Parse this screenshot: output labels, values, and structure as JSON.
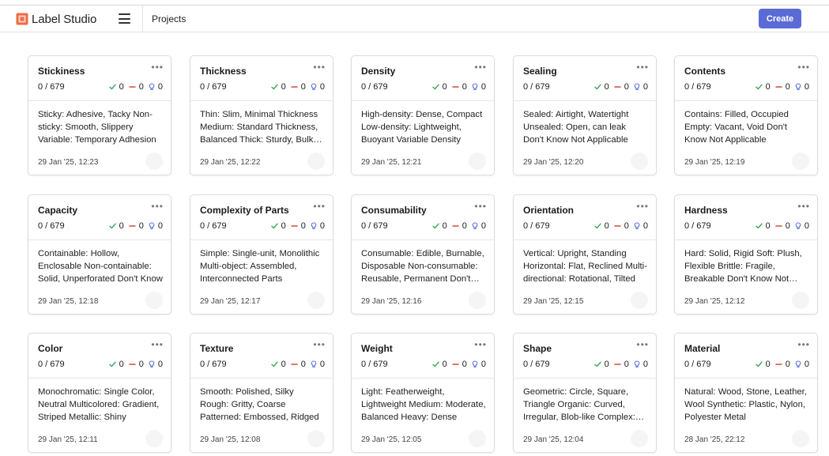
{
  "app": {
    "name": "Label Studio"
  },
  "header": {
    "breadcrumb": "Projects",
    "create_label": "Create"
  },
  "colors": {
    "accent": "#5b6bd5",
    "completed": "#3aa65a",
    "skipped": "#d24a3a",
    "predictions": "#5a6fd8",
    "logo": "#f06c45"
  },
  "icons": {
    "logo": "label-studio-logo",
    "menu": "hamburger-icon",
    "more": "more-dots-icon",
    "completed": "checkmark-icon",
    "skipped": "minus-icon",
    "predictions": "lightbulb-icon"
  },
  "projects": [
    {
      "title": "Stickiness",
      "counts": "0 / 679",
      "completed": "0",
      "skipped": "0",
      "predictions": "0",
      "description": "Sticky: Adhesive, Tacky Non-sticky: Smooth, Slippery Variable: Temporary Adhesion",
      "date": "29 Jan '25, 12:23"
    },
    {
      "title": "Thickness",
      "counts": "0 / 679",
      "completed": "0",
      "skipped": "0",
      "predictions": "0",
      "description": "Thin: Slim, Minimal Thickness Medium: Standard Thickness, Balanced Thick: Sturdy, Bulky Don't Know",
      "date": "29 Jan '25, 12:22"
    },
    {
      "title": "Density",
      "counts": "0 / 679",
      "completed": "0",
      "skipped": "0",
      "predictions": "0",
      "description": "High-density: Dense, Compact Low-density: Lightweight, Buoyant Variable Density",
      "date": "29 Jan '25, 12:21"
    },
    {
      "title": "Sealing",
      "counts": "0 / 679",
      "completed": "0",
      "skipped": "0",
      "predictions": "0",
      "description": "Sealed: Airtight, Watertight Unsealed: Open, can leak Don't Know Not Applicable",
      "date": "29 Jan '25, 12:20"
    },
    {
      "title": "Contents",
      "counts": "0 / 679",
      "completed": "0",
      "skipped": "0",
      "predictions": "0",
      "description": "Contains: Filled, Occupied Empty: Vacant, Void Don't Know Not Applicable",
      "date": "29 Jan '25, 12:19"
    },
    {
      "title": "Capacity",
      "counts": "0 / 679",
      "completed": "0",
      "skipped": "0",
      "predictions": "0",
      "description": "Containable: Hollow, Enclosable Non-containable: Solid, Unperforated Don't Know",
      "date": "29 Jan '25, 12:18"
    },
    {
      "title": "Complexity of Parts",
      "counts": "0 / 679",
      "completed": "0",
      "skipped": "0",
      "predictions": "0",
      "description": "Simple: Single-unit, Monolithic Multi-object: Assembled, Interconnected Parts",
      "date": "29 Jan '25, 12:17"
    },
    {
      "title": "Consumability",
      "counts": "0 / 679",
      "completed": "0",
      "skipped": "0",
      "predictions": "0",
      "description": "Consumable: Edible, Burnable, Disposable Non-consumable: Reusable, Permanent Don't Know",
      "date": "29 Jan '25, 12:16"
    },
    {
      "title": "Orientation",
      "counts": "0 / 679",
      "completed": "0",
      "skipped": "0",
      "predictions": "0",
      "description": "Vertical: Upright, Standing Horizontal: Flat, Reclined Multi-directional: Rotational, Tilted",
      "date": "29 Jan '25, 12:15"
    },
    {
      "title": "Hardness",
      "counts": "0 / 679",
      "completed": "0",
      "skipped": "0",
      "predictions": "0",
      "description": "Hard: Solid, Rigid Soft: Plush, Flexible Brittle: Fragile, Breakable Don't Know Not Applicable",
      "date": "29 Jan '25, 12:12"
    },
    {
      "title": "Color",
      "counts": "0 / 679",
      "completed": "0",
      "skipped": "0",
      "predictions": "0",
      "description": "Monochromatic: Single Color, Neutral Multicolored: Gradient, Striped Metallic: Shiny",
      "date": "29 Jan '25, 12:11"
    },
    {
      "title": "Texture",
      "counts": "0 / 679",
      "completed": "0",
      "skipped": "0",
      "predictions": "0",
      "description": "Smooth: Polished, Silky Rough: Gritty, Coarse Patterned: Embossed, Ridged",
      "date": "29 Jan '25, 12:08"
    },
    {
      "title": "Weight",
      "counts": "0 / 679",
      "completed": "0",
      "skipped": "0",
      "predictions": "0",
      "description": "Light: Featherweight, Lightweight Medium: Moderate, Balanced Heavy: Dense",
      "date": "29 Jan '25, 12:05"
    },
    {
      "title": "Shape",
      "counts": "0 / 679",
      "completed": "0",
      "skipped": "0",
      "predictions": "0",
      "description": "Geometric: Circle, Square, Triangle Organic: Curved, Irregular, Blob-like Complex: Mixed",
      "date": "29 Jan '25, 12:04"
    },
    {
      "title": "Material",
      "counts": "0 / 679",
      "completed": "0",
      "skipped": "0",
      "predictions": "0",
      "description": "Natural: Wood, Stone, Leather, Wool Synthetic: Plastic, Nylon, Polyester Metal",
      "date": "28 Jan '25, 22:12"
    }
  ]
}
